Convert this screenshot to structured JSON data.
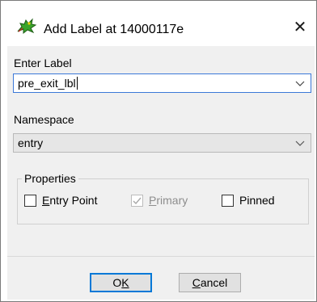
{
  "window": {
    "title": "Add Label at 14000117e",
    "icon": "dragon-icon",
    "close_glyph": "✕"
  },
  "label_field": {
    "label": "Enter Label",
    "value": "pre_exit_lbl"
  },
  "namespace_field": {
    "label": "Namespace",
    "value": "entry"
  },
  "properties": {
    "title": "Properties",
    "entry_point": {
      "label": "Entry Point",
      "mnemonic": "E",
      "rest": "ntry Point",
      "checked": false,
      "enabled": true
    },
    "primary": {
      "label": "Primary",
      "mnemonic": "P",
      "rest": "rimary",
      "checked": true,
      "enabled": false
    },
    "pinned": {
      "label": "Pinned",
      "checked": false,
      "enabled": true
    }
  },
  "buttons": {
    "ok": {
      "label": "OK",
      "mnemonic": "K",
      "prefix": "O"
    },
    "cancel": {
      "label": "Cancel",
      "mnemonic": "C",
      "rest": "ancel"
    }
  },
  "colors": {
    "focus_border": "#3b78d8",
    "client_bg": "#f0f0f0",
    "disabled_text": "#8d8d8d"
  }
}
